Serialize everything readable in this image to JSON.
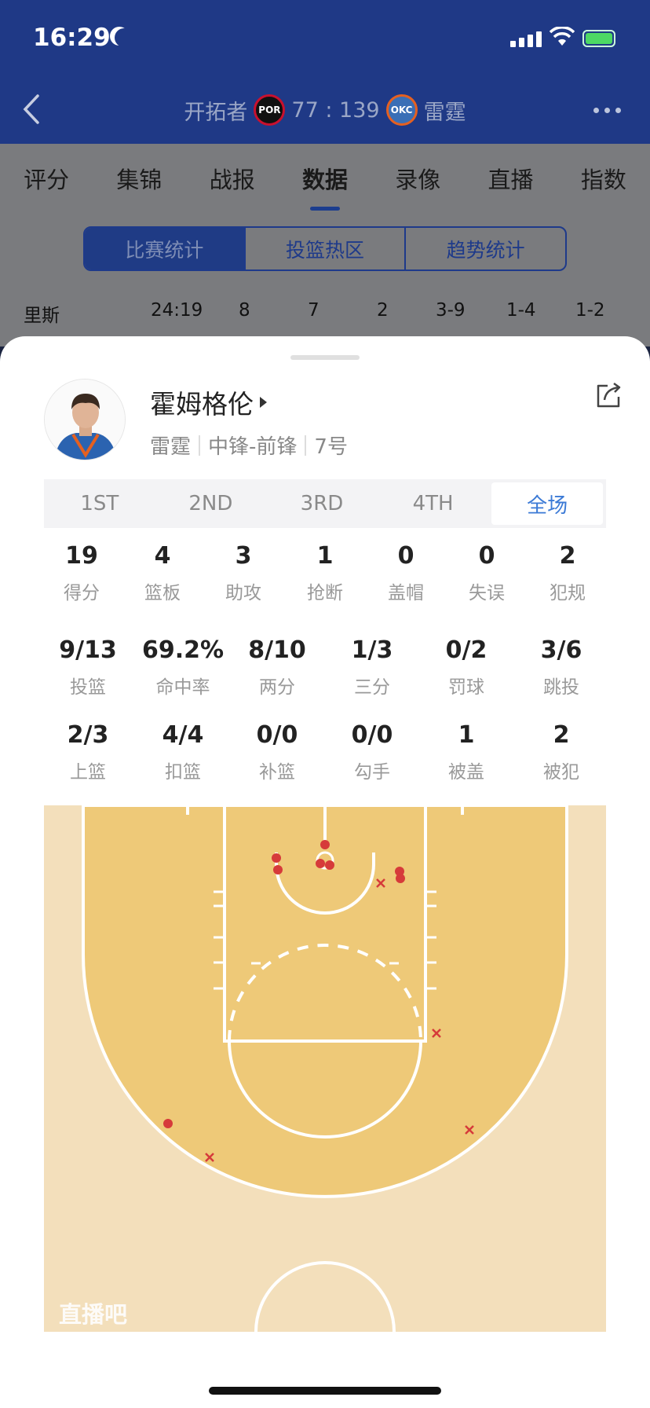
{
  "status": {
    "time": "16:29"
  },
  "header": {
    "home_team": "开拓者",
    "home_logo": "POR",
    "score": "77 : 139",
    "away_logo": "OKC",
    "away_team": "雷霆"
  },
  "tabs": [
    "评分",
    "集锦",
    "战报",
    "数据",
    "录像",
    "直播",
    "指数"
  ],
  "active_tab": "数据",
  "segments": [
    "比赛统计",
    "投篮热区",
    "趋势统计"
  ],
  "active_segment": "比赛统计",
  "background_row": [
    "里斯",
    "24:19",
    "8",
    "7",
    "2",
    "3-9",
    "1-4",
    "1-2"
  ],
  "player": {
    "name": "霍姆格伦",
    "team": "雷霆",
    "position": "中锋-前锋",
    "number": "7号"
  },
  "quarters": [
    "1ST",
    "2ND",
    "3RD",
    "4TH",
    "全场"
  ],
  "active_quarter": "全场",
  "stats_row1": [
    {
      "value": "19",
      "label": "得分"
    },
    {
      "value": "4",
      "label": "篮板"
    },
    {
      "value": "3",
      "label": "助攻"
    },
    {
      "value": "1",
      "label": "抢断"
    },
    {
      "value": "0",
      "label": "盖帽"
    },
    {
      "value": "0",
      "label": "失误"
    },
    {
      "value": "2",
      "label": "犯规"
    }
  ],
  "stats_row2": [
    {
      "value": "9/13",
      "label": "投篮"
    },
    {
      "value": "69.2%",
      "label": "命中率"
    },
    {
      "value": "8/10",
      "label": "两分"
    },
    {
      "value": "1/3",
      "label": "三分"
    },
    {
      "value": "0/2",
      "label": "罚球"
    },
    {
      "value": "3/6",
      "label": "跳投"
    }
  ],
  "stats_row3": [
    {
      "value": "2/3",
      "label": "上篮"
    },
    {
      "value": "4/4",
      "label": "扣篮"
    },
    {
      "value": "0/0",
      "label": "补篮"
    },
    {
      "value": "0/0",
      "label": "勾手"
    },
    {
      "value": "1",
      "label": "被盖"
    },
    {
      "value": "2",
      "label": "被犯"
    }
  ],
  "watermark": "直播吧",
  "colors": {
    "header_bg": "#1f3986",
    "accent_blue": "#3b7ad6",
    "made_shot": "#d63a3a",
    "missed_shot": "#d63a3a",
    "court_paint": "#eec978",
    "court_floor": "#f3dfbb"
  }
}
